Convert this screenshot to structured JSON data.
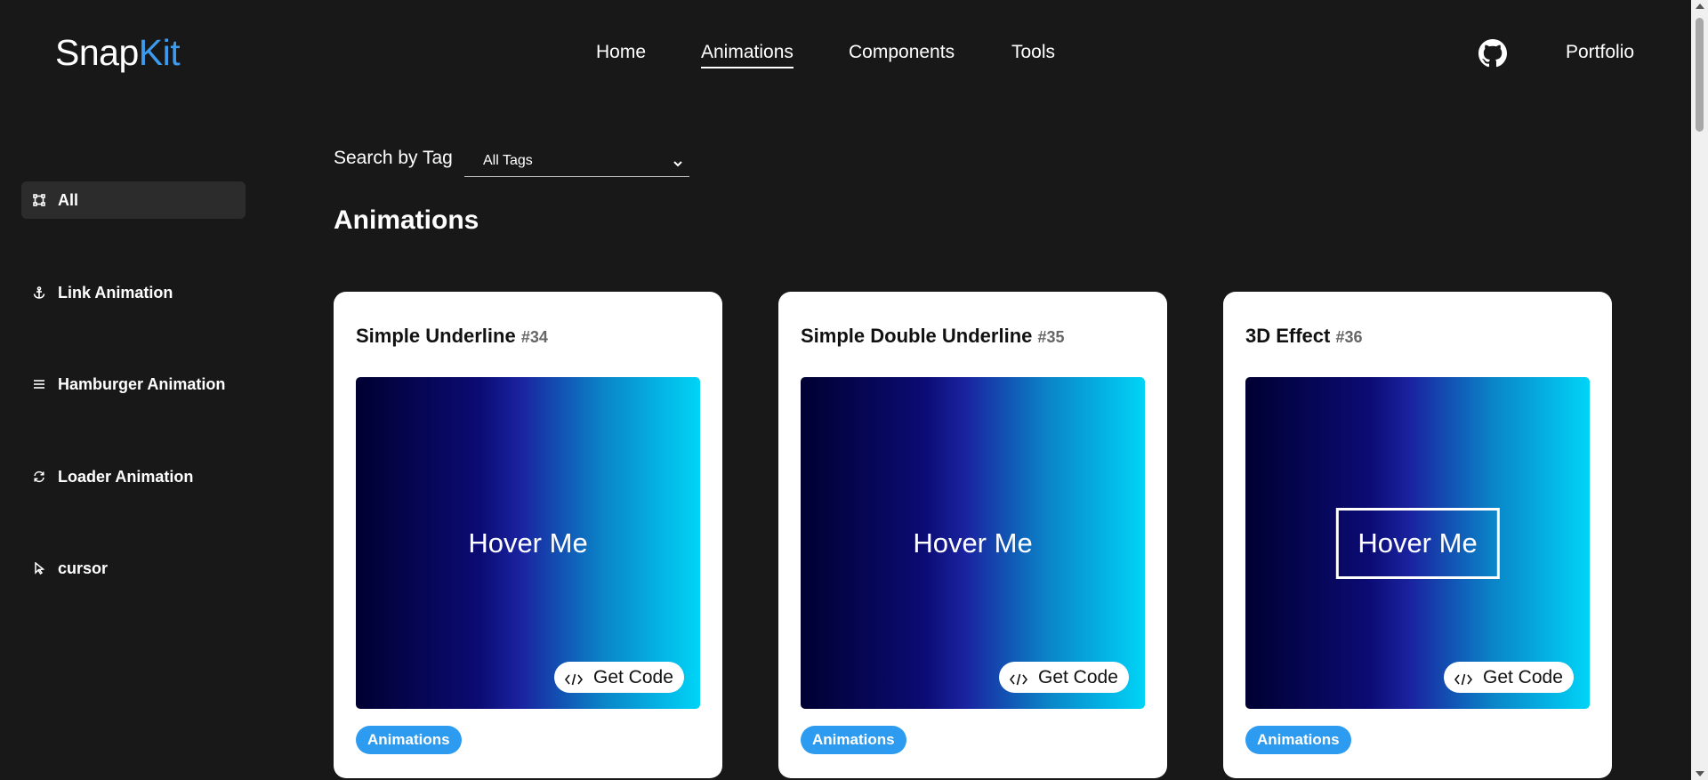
{
  "header": {
    "logo": {
      "part1": "Snap",
      "part2": "Kit"
    },
    "nav": [
      {
        "label": "Home",
        "active": false
      },
      {
        "label": "Animations",
        "active": true
      },
      {
        "label": "Components",
        "active": false
      },
      {
        "label": "Tools",
        "active": false
      }
    ],
    "github_icon": "github-icon",
    "portfolio_label": "Portfolio"
  },
  "sidebar": {
    "items": [
      {
        "label": "All",
        "icon": "all-icon",
        "active": true
      },
      {
        "label": "Link Animation",
        "icon": "anchor-icon",
        "active": false
      },
      {
        "label": "Hamburger Animation",
        "icon": "menu-icon",
        "active": false
      },
      {
        "label": "Loader Animation",
        "icon": "refresh-icon",
        "active": false
      },
      {
        "label": "cursor",
        "icon": "cursor-icon",
        "active": false
      }
    ]
  },
  "search": {
    "label": "Search by Tag",
    "selected": "All Tags"
  },
  "main": {
    "title": "Animations",
    "cards": [
      {
        "title": "Simple Underline",
        "number": "#34",
        "preview_text": "Hover Me",
        "button": "Get Code",
        "tag": "Animations"
      },
      {
        "title": "Simple Double Underline",
        "number": "#35",
        "preview_text": "Hover Me",
        "button": "Get Code",
        "tag": "Animations"
      },
      {
        "title": "3D Effect",
        "number": "#36",
        "preview_text": "Hover Me",
        "button": "Get Code",
        "tag": "Animations"
      }
    ]
  },
  "colors": {
    "background": "#181818",
    "accent": "#3d9bef",
    "tag": "#2d9cf0",
    "card": "#ffffff"
  }
}
